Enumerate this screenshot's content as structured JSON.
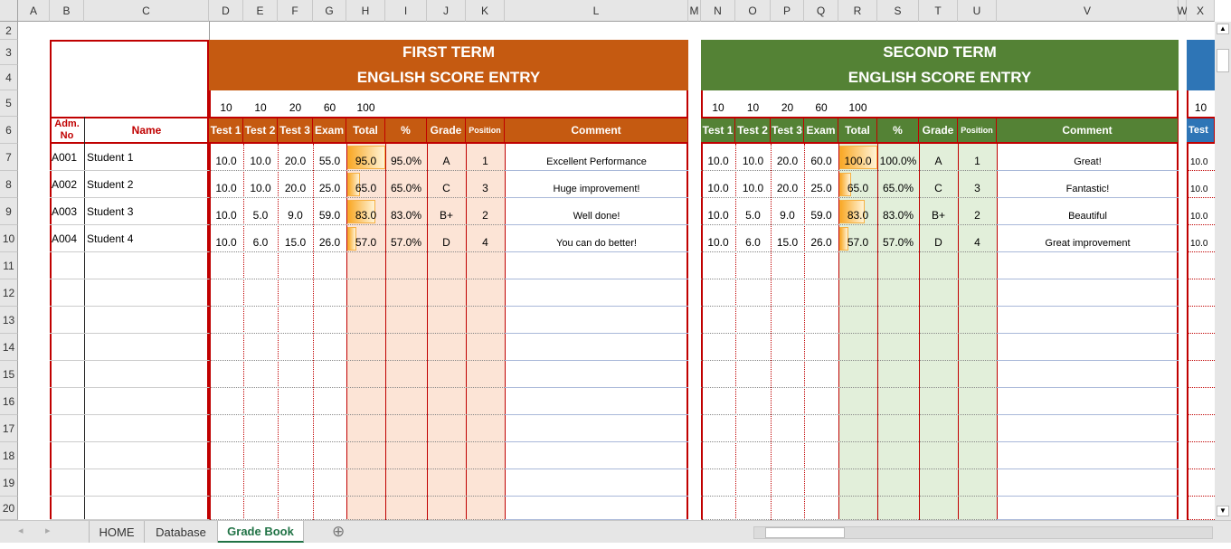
{
  "columns": [
    "A",
    "B",
    "C",
    "D",
    "E",
    "F",
    "G",
    "H",
    "I",
    "J",
    "K",
    "L",
    "M",
    "N",
    "O",
    "P",
    "Q",
    "R",
    "S",
    "T",
    "U",
    "V",
    "W",
    "X"
  ],
  "rows": [
    "2",
    "3",
    "4",
    "5",
    "6",
    "7",
    "8",
    "9",
    "10",
    "11",
    "12",
    "13",
    "14",
    "15",
    "16",
    "17",
    "18",
    "19",
    "20"
  ],
  "student_headers": {
    "adm_no": "Adm. No",
    "name": "Name"
  },
  "students": [
    {
      "adm": "A001",
      "name": "Student 1"
    },
    {
      "adm": "A002",
      "name": "Student 2"
    },
    {
      "adm": "A003",
      "name": "Student 3"
    },
    {
      "adm": "A004",
      "name": "Student 4"
    }
  ],
  "max_scores": [
    "10",
    "10",
    "20",
    "60",
    "100"
  ],
  "score_headers": [
    "Test 1",
    "Test 2",
    "Test 3",
    "Exam",
    "Total",
    "%",
    "Grade",
    "Position",
    "Comment"
  ],
  "terms": [
    {
      "title": "FIRST TERM",
      "subtitle": "ENGLISH SCORE ENTRY",
      "color": "#c55a11",
      "fill": "#fce4d6",
      "rows": [
        [
          "10.0",
          "10.0",
          "20.0",
          "55.0",
          "95.0",
          "95.0%",
          "A",
          "1",
          "Excellent Performance"
        ],
        [
          "10.0",
          "10.0",
          "20.0",
          "25.0",
          "65.0",
          "65.0%",
          "C",
          "3",
          "Huge improvement!"
        ],
        [
          "10.0",
          "5.0",
          "9.0",
          "59.0",
          "83.0",
          "83.0%",
          "B+",
          "2",
          "Well done!"
        ],
        [
          "10.0",
          "6.0",
          "15.0",
          "26.0",
          "57.0",
          "57.0%",
          "D",
          "4",
          "You can do better!"
        ]
      ]
    },
    {
      "title": "SECOND TERM",
      "subtitle": "ENGLISH SCORE ENTRY",
      "color": "#548235",
      "fill": "#e2efda",
      "rows": [
        [
          "10.0",
          "10.0",
          "20.0",
          "60.0",
          "100.0",
          "100.0%",
          "A",
          "1",
          "Great!"
        ],
        [
          "10.0",
          "10.0",
          "20.0",
          "25.0",
          "65.0",
          "65.0%",
          "C",
          "3",
          "Fantastic!"
        ],
        [
          "10.0",
          "5.0",
          "9.0",
          "59.0",
          "83.0",
          "83.0%",
          "B+",
          "2",
          "Beautiful"
        ],
        [
          "10.0",
          "6.0",
          "15.0",
          "26.0",
          "57.0",
          "57.0%",
          "D",
          "4",
          "Great improvement"
        ]
      ]
    }
  ],
  "third_term": {
    "color": "#2e75b6",
    "max": "10",
    "header": "Test",
    "values": [
      "10.0",
      "10.0",
      "10.0",
      "10.0"
    ]
  },
  "sheet_tabs": [
    {
      "label": "HOME",
      "active": false
    },
    {
      "label": "Database",
      "active": false
    },
    {
      "label": "Grade Book",
      "active": true
    }
  ],
  "add_sheet": "⊕"
}
